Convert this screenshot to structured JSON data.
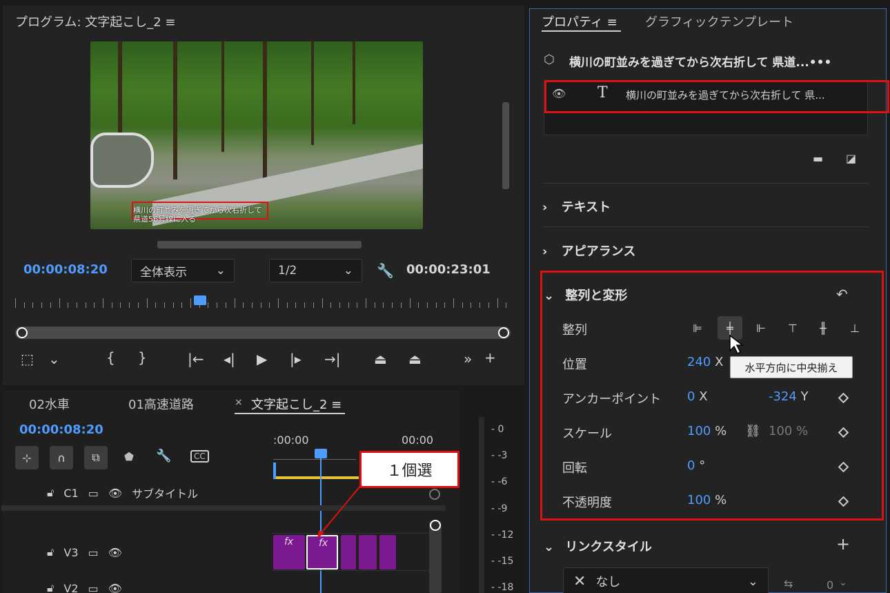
{
  "program": {
    "title": "プログラム: 文字起こし_2 ≡",
    "caption_line1": "横川の町並みを過ぎてから次右折して",
    "caption_line2": "県道56号線に入る",
    "timecode_current": "00:00:08:20",
    "zoom_select": "全体表示",
    "resolution_select": "1/2",
    "timecode_duration": "00:00:23:01"
  },
  "timeline": {
    "tabs": [
      "02水車",
      "01高速道路",
      "文字起こし_2 ≡"
    ],
    "close_mark": "×",
    "timecode": "00:00:08:20",
    "ruler_labels": [
      ":00:00",
      "00:00"
    ],
    "tracks": [
      {
        "id": "C1",
        "name": "サブタイトル"
      },
      {
        "id": "V3",
        "name": ""
      },
      {
        "id": "V2",
        "name": ""
      }
    ],
    "fx_label": "fx",
    "callout": "１個選",
    "cc_label": "CC"
  },
  "meter": {
    "labels": [
      "- 0",
      "- -3",
      "- -6",
      "- -9",
      "- -12",
      "- -15",
      "- -18"
    ]
  },
  "properties": {
    "tabs": [
      "プロパティ ≡",
      "グラフィックテンプレート"
    ],
    "title": "横川の町並みを過ぎてから次右折して 県道...•••",
    "layer_text": "横川の町並みを過ぎてから次右折して 県...",
    "sections": {
      "text": "テキスト",
      "appearance": "アピアランス",
      "align_transform": "整列と変形",
      "link_style": "リンクスタイル"
    },
    "align_label": "整列",
    "tooltip": "水平方向に中央揃え",
    "rows": {
      "position": {
        "label": "位置",
        "x": "240",
        "x_unit": "X"
      },
      "anchor": {
        "label": "アンカーポイント",
        "x": "0",
        "x_unit": "X",
        "y": "-324",
        "y_unit": "Y"
      },
      "scale": {
        "label": "スケール",
        "v": "100",
        "unit": "%",
        "v2": "100 %"
      },
      "rotation": {
        "label": "回転",
        "v": "0",
        "unit": "°"
      },
      "opacity": {
        "label": "不透明度",
        "v": "100",
        "unit": "%"
      }
    },
    "link_style_select": "なし",
    "link_count": "0"
  },
  "colors": {
    "accent": "#4f9cff",
    "highlight": "#dd1111",
    "clip": "#7b1a90"
  }
}
